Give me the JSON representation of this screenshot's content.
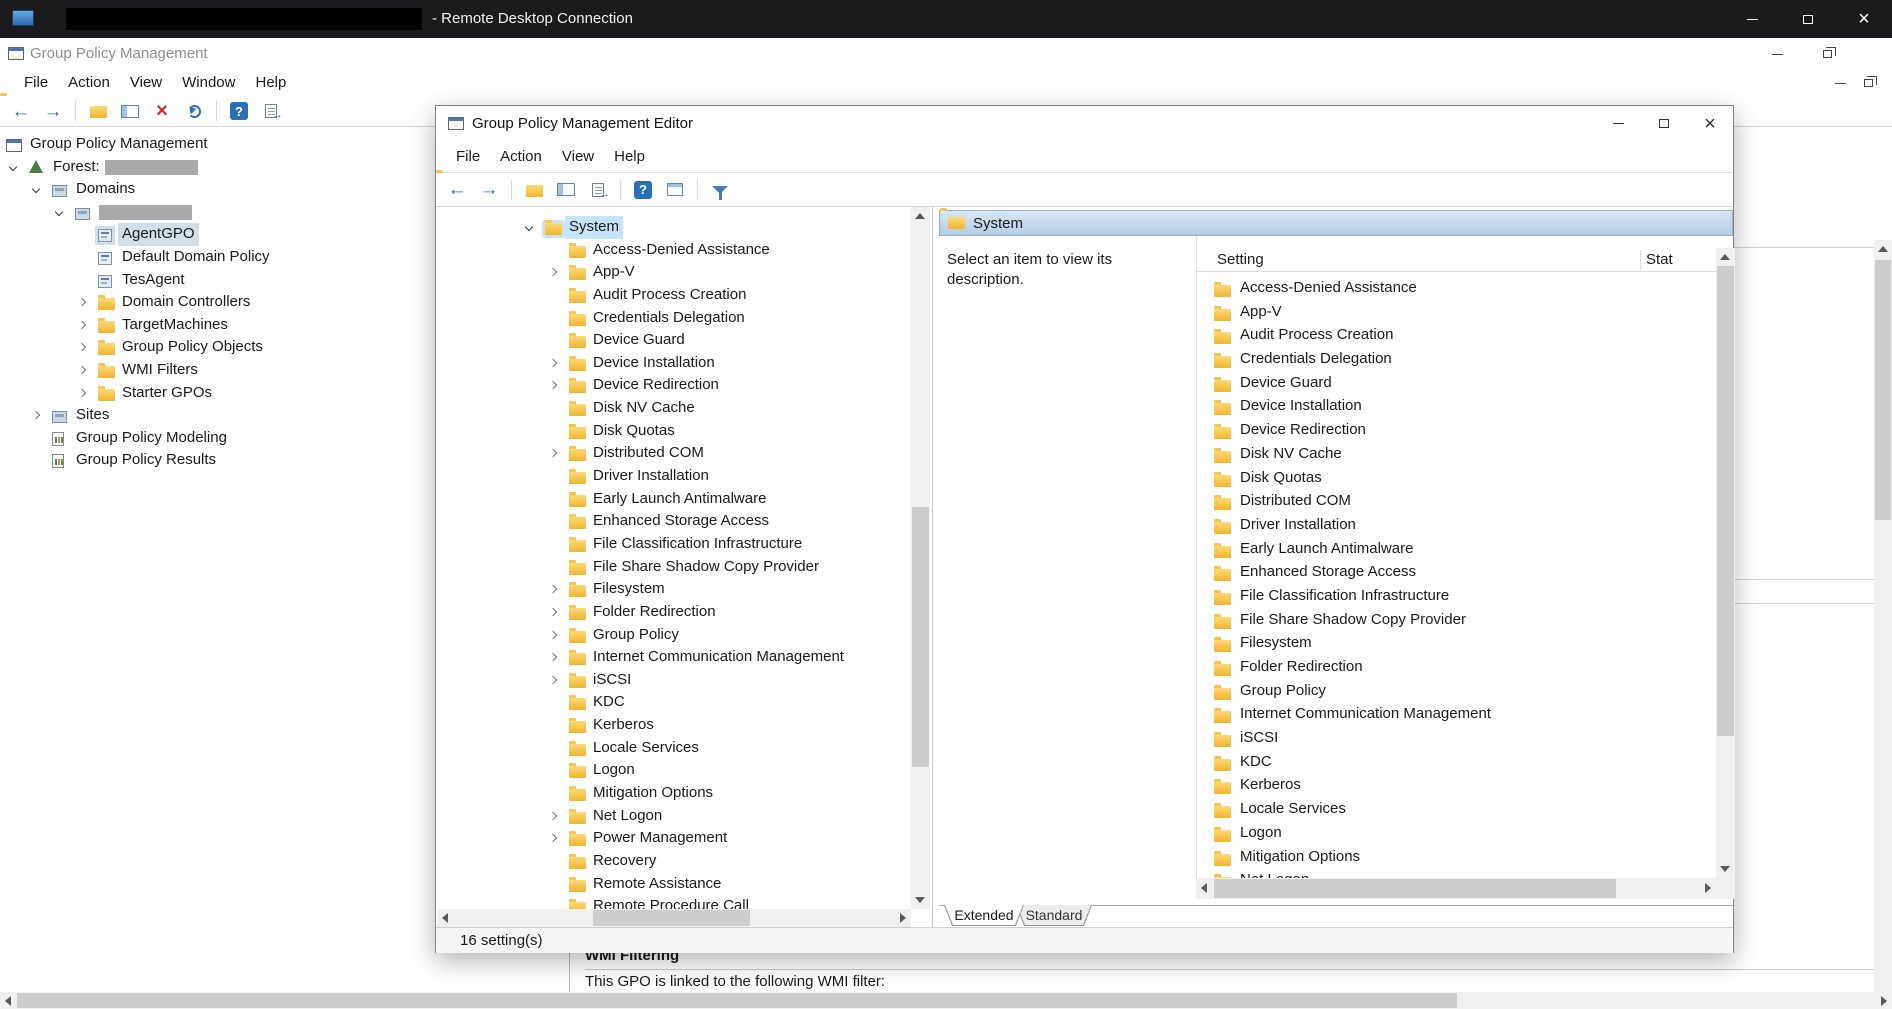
{
  "rdp": {
    "title": "- Remote Desktop Connection",
    "redacted_host": true
  },
  "gpm": {
    "title": "Group Policy Management",
    "menu": [
      "File",
      "Action",
      "View",
      "Window",
      "Help"
    ],
    "toolbar_icons": [
      "back",
      "forward",
      "up-one-level",
      "show-console-tree",
      "delete",
      "refresh",
      "help",
      "export-list"
    ],
    "tree": [
      {
        "label": "Group Policy Management",
        "level": 0,
        "icon": "console"
      },
      {
        "label": "Forest:",
        "level": 1,
        "icon": "forest",
        "expand": "expanded",
        "redacted": true
      },
      {
        "label": "Domains",
        "level": 2,
        "icon": "domains",
        "expand": "expanded"
      },
      {
        "label": "",
        "level": 3,
        "icon": "domain",
        "expand": "expanded",
        "redacted": true
      },
      {
        "label": "AgentGPO",
        "level": 4,
        "icon": "gpo",
        "selected": true
      },
      {
        "label": "Default Domain Policy",
        "level": 4,
        "icon": "gpo"
      },
      {
        "label": "TesAgent",
        "level": 4,
        "icon": "gpo"
      },
      {
        "label": "Domain Controllers",
        "level": 4,
        "icon": "folder",
        "expand": "collapsed"
      },
      {
        "label": "TargetMachines",
        "level": 4,
        "icon": "folder",
        "expand": "collapsed"
      },
      {
        "label": "Group Policy Objects",
        "level": 4,
        "icon": "folder",
        "expand": "collapsed"
      },
      {
        "label": "WMI Filters",
        "level": 4,
        "icon": "folder",
        "expand": "collapsed"
      },
      {
        "label": "Starter GPOs",
        "level": 4,
        "icon": "folder",
        "expand": "collapsed"
      },
      {
        "label": "Sites",
        "level": 2,
        "icon": "sites",
        "expand": "collapsed"
      },
      {
        "label": "Group Policy Modeling",
        "level": 2,
        "icon": "report"
      },
      {
        "label": "Group Policy Results",
        "level": 2,
        "icon": "report"
      }
    ],
    "wmi_section": {
      "heading": "WMI Filtering",
      "description": "This GPO is linked to the following WMI filter:"
    }
  },
  "editor": {
    "title": "Group Policy Management Editor",
    "menu": [
      "File",
      "Action",
      "View",
      "Help"
    ],
    "toolbar_icons": [
      "back",
      "forward",
      "up-one-level",
      "show-console-tree",
      "export-list",
      "help",
      "properties",
      "filter"
    ],
    "tree": [
      {
        "label": "System",
        "level": 0,
        "icon": "folder",
        "expand": "expanded",
        "selected": true
      },
      {
        "label": "Access-Denied Assistance",
        "level": 1,
        "icon": "folder"
      },
      {
        "label": "App-V",
        "level": 1,
        "icon": "folder",
        "expand": "collapsed"
      },
      {
        "label": "Audit Process Creation",
        "level": 1,
        "icon": "folder"
      },
      {
        "label": "Credentials Delegation",
        "level": 1,
        "icon": "folder"
      },
      {
        "label": "Device Guard",
        "level": 1,
        "icon": "folder"
      },
      {
        "label": "Device Installation",
        "level": 1,
        "icon": "folder",
        "expand": "collapsed"
      },
      {
        "label": "Device Redirection",
        "level": 1,
        "icon": "folder",
        "expand": "collapsed"
      },
      {
        "label": "Disk NV Cache",
        "level": 1,
        "icon": "folder"
      },
      {
        "label": "Disk Quotas",
        "level": 1,
        "icon": "folder"
      },
      {
        "label": "Distributed COM",
        "level": 1,
        "icon": "folder",
        "expand": "collapsed"
      },
      {
        "label": "Driver Installation",
        "level": 1,
        "icon": "folder"
      },
      {
        "label": "Early Launch Antimalware",
        "level": 1,
        "icon": "folder"
      },
      {
        "label": "Enhanced Storage Access",
        "level": 1,
        "icon": "folder"
      },
      {
        "label": "File Classification Infrastructure",
        "level": 1,
        "icon": "folder"
      },
      {
        "label": "File Share Shadow Copy Provider",
        "level": 1,
        "icon": "folder"
      },
      {
        "label": "Filesystem",
        "level": 1,
        "icon": "folder",
        "expand": "collapsed"
      },
      {
        "label": "Folder Redirection",
        "level": 1,
        "icon": "folder",
        "expand": "collapsed"
      },
      {
        "label": "Group Policy",
        "level": 1,
        "icon": "folder",
        "expand": "collapsed"
      },
      {
        "label": "Internet Communication Management",
        "level": 1,
        "icon": "folder",
        "expand": "collapsed"
      },
      {
        "label": "iSCSI",
        "level": 1,
        "icon": "folder",
        "expand": "collapsed"
      },
      {
        "label": "KDC",
        "level": 1,
        "icon": "folder"
      },
      {
        "label": "Kerberos",
        "level": 1,
        "icon": "folder"
      },
      {
        "label": "Locale Services",
        "level": 1,
        "icon": "folder"
      },
      {
        "label": "Logon",
        "level": 1,
        "icon": "folder"
      },
      {
        "label": "Mitigation Options",
        "level": 1,
        "icon": "folder"
      },
      {
        "label": "Net Logon",
        "level": 1,
        "icon": "folder",
        "expand": "collapsed"
      },
      {
        "label": "Power Management",
        "level": 1,
        "icon": "folder",
        "expand": "collapsed"
      },
      {
        "label": "Recovery",
        "level": 1,
        "icon": "folder"
      },
      {
        "label": "Remote Assistance",
        "level": 1,
        "icon": "folder"
      },
      {
        "label": "Remote Procedure Call",
        "level": 1,
        "icon": "folder"
      }
    ],
    "right_pane": {
      "header": "System",
      "description": "Select an item to view its description.",
      "columns": [
        "Setting",
        "Stat"
      ],
      "items": [
        "Access-Denied Assistance",
        "App-V",
        "Audit Process Creation",
        "Credentials Delegation",
        "Device Guard",
        "Device Installation",
        "Device Redirection",
        "Disk NV Cache",
        "Disk Quotas",
        "Distributed COM",
        "Driver Installation",
        "Early Launch Antimalware",
        "Enhanced Storage Access",
        "File Classification Infrastructure",
        "File Share Shadow Copy Provider",
        "Filesystem",
        "Folder Redirection",
        "Group Policy",
        "Internet Communication Management",
        "iSCSI",
        "KDC",
        "Kerberos",
        "Locale Services",
        "Logon",
        "Mitigation Options",
        "Net Logon"
      ],
      "tabs": [
        {
          "label": "Extended",
          "active": true
        },
        {
          "label": "Standard",
          "active": false
        }
      ]
    },
    "status_bar": "16 setting(s)"
  },
  "colors": {
    "rdp_titlebar": "#1b1b1e",
    "selection_active": "#c6e4f8",
    "selection_inactive": "#d2dfe9",
    "folder": "#f0b42f",
    "accent_blue": "#2a70b8"
  }
}
